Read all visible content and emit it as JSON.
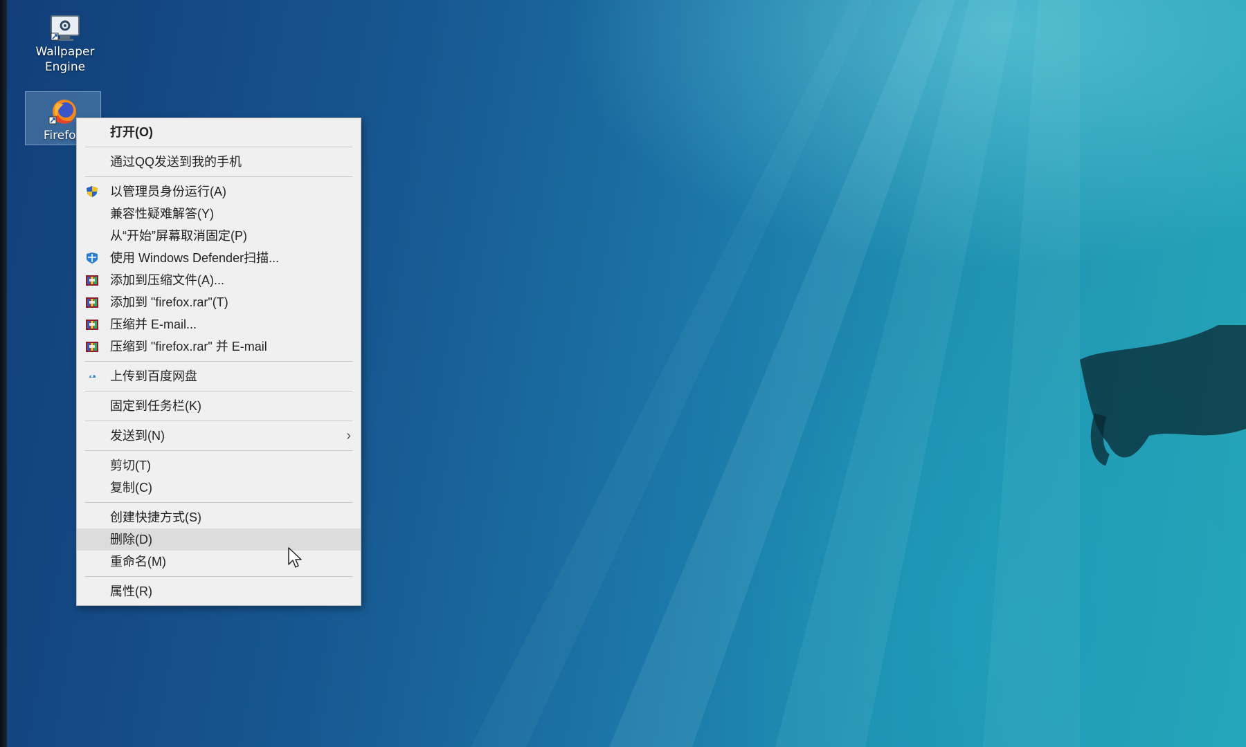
{
  "desktop": {
    "icons": [
      {
        "label": "Wallpaper\nEngine",
        "icon": "wallpaper-engine-icon"
      },
      {
        "label": "Firefox",
        "icon": "firefox-icon"
      }
    ]
  },
  "context_menu": {
    "items": {
      "open": "打开(O)",
      "qq_send": "通过QQ发送到我的手机",
      "run_as_admin": "以管理员身份运行(A)",
      "compat": "兼容性疑难解答(Y)",
      "unpin_start": "从“开始”屏幕取消固定(P)",
      "defender": "使用 Windows Defender扫描...",
      "add_archive": "添加到压缩文件(A)...",
      "add_firefox_rar": "添加到 \"firefox.rar\"(T)",
      "compress_email": "压缩并 E-mail...",
      "compress_rar_email": "压缩到 \"firefox.rar\" 并 E-mail",
      "baidu": "上传到百度网盘",
      "pin_taskbar": "固定到任务栏(K)",
      "send_to": "发送到(N)",
      "cut": "剪切(T)",
      "copy": "复制(C)",
      "create_shortcut": "创建快捷方式(S)",
      "delete": "删除(D)",
      "rename": "重命名(M)",
      "properties": "属性(R)"
    },
    "hovered_item": "delete"
  },
  "colors": {
    "menu_background": "#f0f0f0",
    "menu_hover": "#dcdcdc",
    "desktop_deep": "#123e78",
    "desktop_light": "#27a8b8"
  }
}
